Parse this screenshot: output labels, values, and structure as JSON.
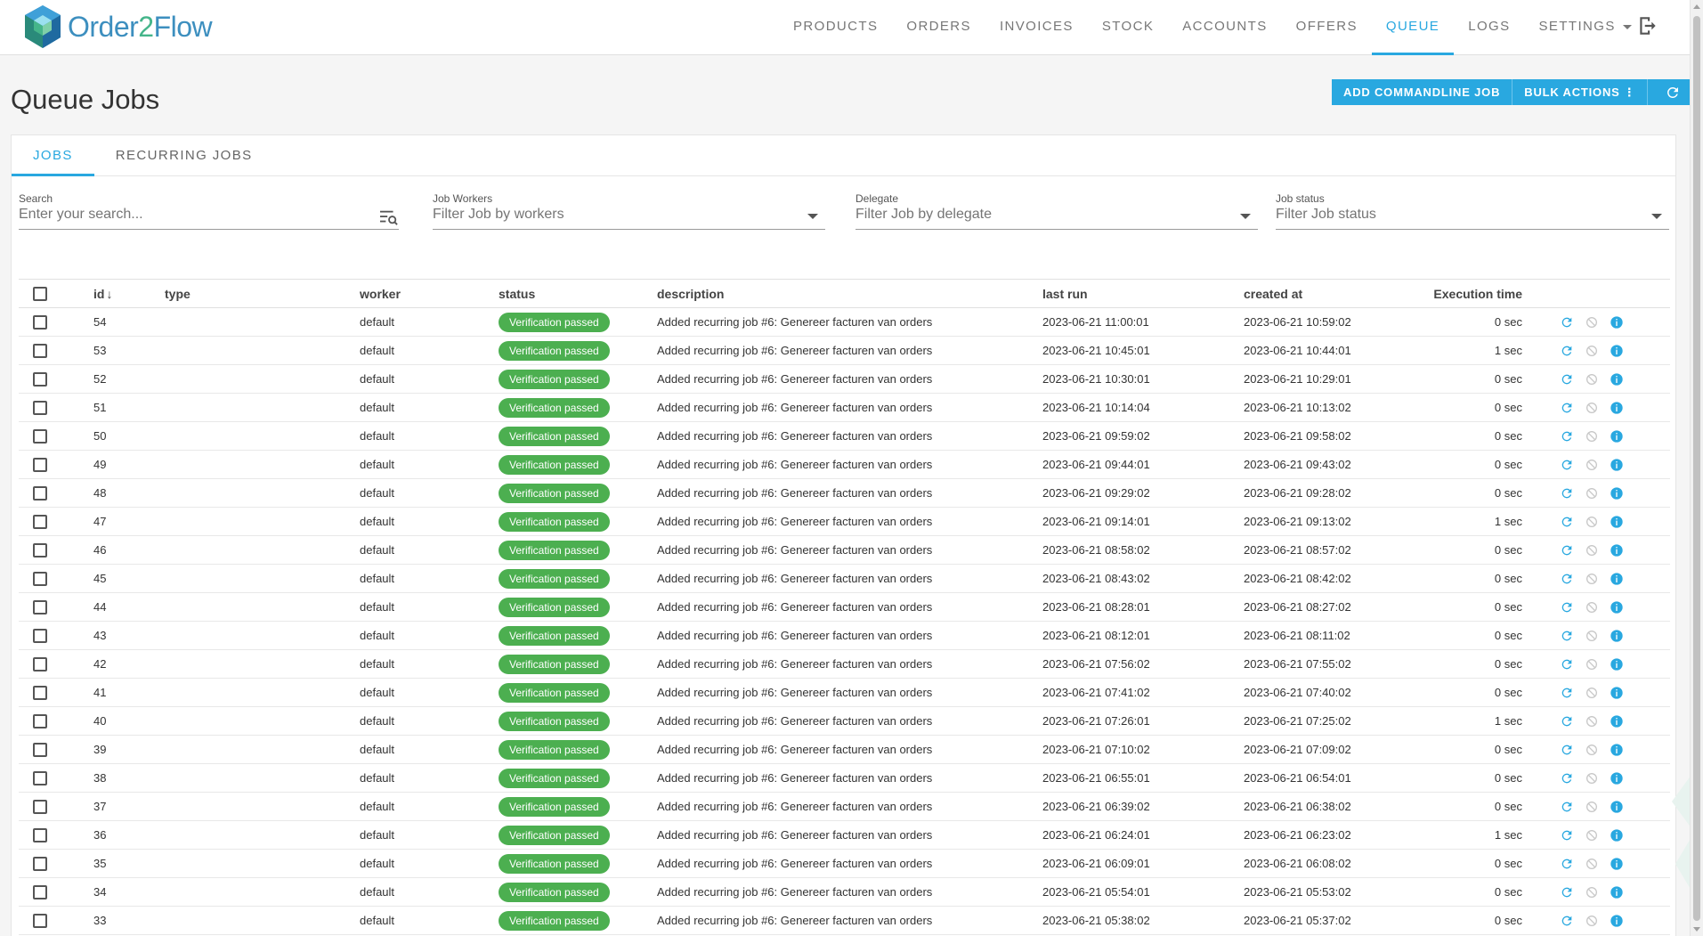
{
  "app": {
    "logo_text_a": "Order",
    "logo_text_b": "2",
    "logo_text_c": "Flow",
    "brand_blue": "#3d8fbf",
    "brand_green": "#45b58a",
    "accent": "#29a8e0"
  },
  "nav": {
    "items": [
      {
        "label": "PRODUCTS"
      },
      {
        "label": "ORDERS"
      },
      {
        "label": "INVOICES"
      },
      {
        "label": "STOCK"
      },
      {
        "label": "ACCOUNTS"
      },
      {
        "label": "OFFERS"
      },
      {
        "label": "QUEUE",
        "active": true
      },
      {
        "label": "LOGS"
      },
      {
        "label": "SETTINGS",
        "dropdown": true
      }
    ],
    "logout_icon": "logout-icon"
  },
  "page": {
    "title": "Queue Jobs",
    "actions": {
      "add_commandline_job": "ADD COMMANDLINE JOB",
      "bulk_actions": "BULK ACTIONS",
      "refresh_icon": "refresh-icon"
    }
  },
  "tabs": [
    {
      "label": "JOBS",
      "active": true
    },
    {
      "label": "RECURRING JOBS"
    }
  ],
  "filters": {
    "search": {
      "label": "Search",
      "placeholder": "Enter your search..."
    },
    "workers": {
      "label": "Job Workers",
      "placeholder": "Filter Job by workers"
    },
    "delegate": {
      "label": "Delegate",
      "placeholder": "Filter Job by delegate"
    },
    "status": {
      "label": "Job status",
      "placeholder": "Filter Job status"
    }
  },
  "table": {
    "headers": {
      "id": "id",
      "type": "type",
      "worker": "worker",
      "status": "status",
      "description": "description",
      "last_run": "last run",
      "created_at": "created at",
      "execution_time": "Execution time"
    },
    "status_color": "#4caf50",
    "rows": [
      {
        "id": "54",
        "type": "",
        "worker": "default",
        "status": "Verification passed",
        "description": "Added recurring job #6: Genereer facturen van orders",
        "last_run": "2023-06-21 11:00:01",
        "created_at": "2023-06-21 10:59:02",
        "execution_time": "0 sec"
      },
      {
        "id": "53",
        "type": "",
        "worker": "default",
        "status": "Verification passed",
        "description": "Added recurring job #6: Genereer facturen van orders",
        "last_run": "2023-06-21 10:45:01",
        "created_at": "2023-06-21 10:44:01",
        "execution_time": "1 sec"
      },
      {
        "id": "52",
        "type": "",
        "worker": "default",
        "status": "Verification passed",
        "description": "Added recurring job #6: Genereer facturen van orders",
        "last_run": "2023-06-21 10:30:01",
        "created_at": "2023-06-21 10:29:01",
        "execution_time": "0 sec"
      },
      {
        "id": "51",
        "type": "",
        "worker": "default",
        "status": "Verification passed",
        "description": "Added recurring job #6: Genereer facturen van orders",
        "last_run": "2023-06-21 10:14:04",
        "created_at": "2023-06-21 10:13:02",
        "execution_time": "0 sec"
      },
      {
        "id": "50",
        "type": "",
        "worker": "default",
        "status": "Verification passed",
        "description": "Added recurring job #6: Genereer facturen van orders",
        "last_run": "2023-06-21 09:59:02",
        "created_at": "2023-06-21 09:58:02",
        "execution_time": "0 sec"
      },
      {
        "id": "49",
        "type": "",
        "worker": "default",
        "status": "Verification passed",
        "description": "Added recurring job #6: Genereer facturen van orders",
        "last_run": "2023-06-21 09:44:01",
        "created_at": "2023-06-21 09:43:02",
        "execution_time": "0 sec"
      },
      {
        "id": "48",
        "type": "",
        "worker": "default",
        "status": "Verification passed",
        "description": "Added recurring job #6: Genereer facturen van orders",
        "last_run": "2023-06-21 09:29:02",
        "created_at": "2023-06-21 09:28:02",
        "execution_time": "0 sec"
      },
      {
        "id": "47",
        "type": "",
        "worker": "default",
        "status": "Verification passed",
        "description": "Added recurring job #6: Genereer facturen van orders",
        "last_run": "2023-06-21 09:14:01",
        "created_at": "2023-06-21 09:13:02",
        "execution_time": "1 sec"
      },
      {
        "id": "46",
        "type": "",
        "worker": "default",
        "status": "Verification passed",
        "description": "Added recurring job #6: Genereer facturen van orders",
        "last_run": "2023-06-21 08:58:02",
        "created_at": "2023-06-21 08:57:02",
        "execution_time": "0 sec"
      },
      {
        "id": "45",
        "type": "",
        "worker": "default",
        "status": "Verification passed",
        "description": "Added recurring job #6: Genereer facturen van orders",
        "last_run": "2023-06-21 08:43:02",
        "created_at": "2023-06-21 08:42:02",
        "execution_time": "0 sec"
      },
      {
        "id": "44",
        "type": "",
        "worker": "default",
        "status": "Verification passed",
        "description": "Added recurring job #6: Genereer facturen van orders",
        "last_run": "2023-06-21 08:28:01",
        "created_at": "2023-06-21 08:27:02",
        "execution_time": "0 sec"
      },
      {
        "id": "43",
        "type": "",
        "worker": "default",
        "status": "Verification passed",
        "description": "Added recurring job #6: Genereer facturen van orders",
        "last_run": "2023-06-21 08:12:01",
        "created_at": "2023-06-21 08:11:02",
        "execution_time": "0 sec"
      },
      {
        "id": "42",
        "type": "",
        "worker": "default",
        "status": "Verification passed",
        "description": "Added recurring job #6: Genereer facturen van orders",
        "last_run": "2023-06-21 07:56:02",
        "created_at": "2023-06-21 07:55:02",
        "execution_time": "0 sec"
      },
      {
        "id": "41",
        "type": "",
        "worker": "default",
        "status": "Verification passed",
        "description": "Added recurring job #6: Genereer facturen van orders",
        "last_run": "2023-06-21 07:41:02",
        "created_at": "2023-06-21 07:40:02",
        "execution_time": "0 sec"
      },
      {
        "id": "40",
        "type": "",
        "worker": "default",
        "status": "Verification passed",
        "description": "Added recurring job #6: Genereer facturen van orders",
        "last_run": "2023-06-21 07:26:01",
        "created_at": "2023-06-21 07:25:02",
        "execution_time": "1 sec"
      },
      {
        "id": "39",
        "type": "",
        "worker": "default",
        "status": "Verification passed",
        "description": "Added recurring job #6: Genereer facturen van orders",
        "last_run": "2023-06-21 07:10:02",
        "created_at": "2023-06-21 07:09:02",
        "execution_time": "0 sec"
      },
      {
        "id": "38",
        "type": "",
        "worker": "default",
        "status": "Verification passed",
        "description": "Added recurring job #6: Genereer facturen van orders",
        "last_run": "2023-06-21 06:55:01",
        "created_at": "2023-06-21 06:54:01",
        "execution_time": "0 sec"
      },
      {
        "id": "37",
        "type": "",
        "worker": "default",
        "status": "Verification passed",
        "description": "Added recurring job #6: Genereer facturen van orders",
        "last_run": "2023-06-21 06:39:02",
        "created_at": "2023-06-21 06:38:02",
        "execution_time": "0 sec"
      },
      {
        "id": "36",
        "type": "",
        "worker": "default",
        "status": "Verification passed",
        "description": "Added recurring job #6: Genereer facturen van orders",
        "last_run": "2023-06-21 06:24:01",
        "created_at": "2023-06-21 06:23:02",
        "execution_time": "1 sec"
      },
      {
        "id": "35",
        "type": "",
        "worker": "default",
        "status": "Verification passed",
        "description": "Added recurring job #6: Genereer facturen van orders",
        "last_run": "2023-06-21 06:09:01",
        "created_at": "2023-06-21 06:08:02",
        "execution_time": "0 sec"
      },
      {
        "id": "34",
        "type": "",
        "worker": "default",
        "status": "Verification passed",
        "description": "Added recurring job #6: Genereer facturen van orders",
        "last_run": "2023-06-21 05:54:01",
        "created_at": "2023-06-21 05:53:02",
        "execution_time": "0 sec"
      },
      {
        "id": "33",
        "type": "",
        "worker": "default",
        "status": "Verification passed",
        "description": "Added recurring job #6: Genereer facturen van orders",
        "last_run": "2023-06-21 05:38:02",
        "created_at": "2023-06-21 05:37:02",
        "execution_time": "0 sec"
      }
    ],
    "row_icons": [
      "retry-icon",
      "cancel-icon",
      "info-icon"
    ]
  }
}
